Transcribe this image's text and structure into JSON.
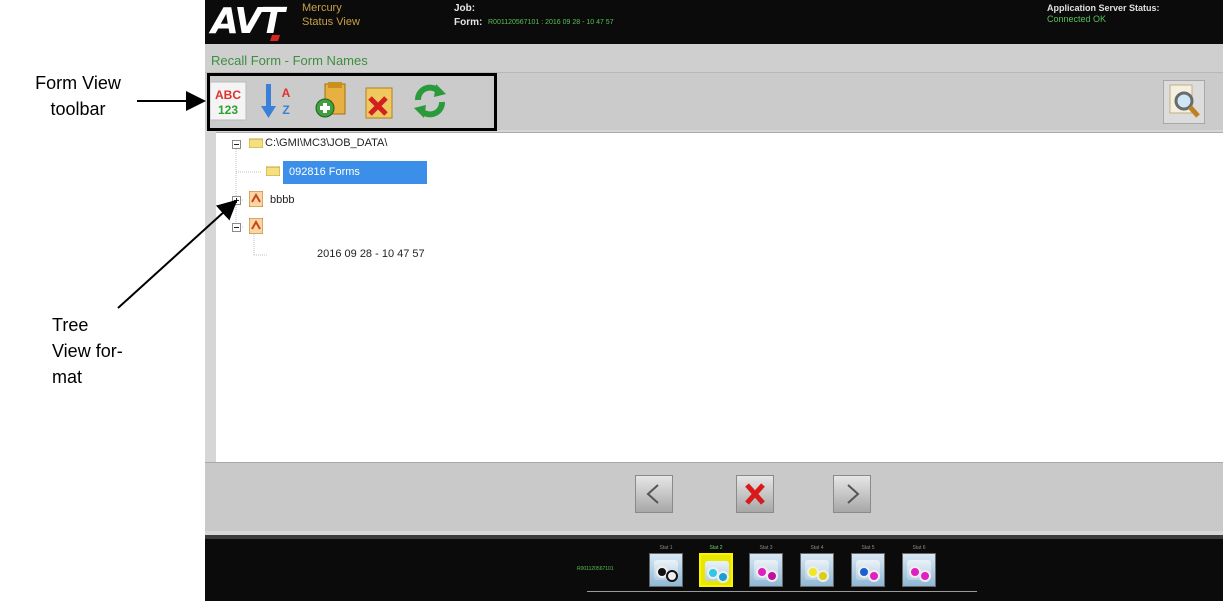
{
  "annotations": {
    "toolbar_label_line1": "Form View",
    "toolbar_label_line2": "toolbar",
    "tree_label_line1": "Tree",
    "tree_label_line2": "View for-",
    "tree_label_line3": "mat"
  },
  "header": {
    "logo": "AVT",
    "app_name": "Mercury",
    "app_sub": "Status View",
    "job_label": "Job:",
    "form_label": "Form:",
    "form_value": "R001120567101 : 2016 09 28 - 10 47 57",
    "server_label": "Application Server Status:",
    "server_value": "Connected OK"
  },
  "subtitle": "Recall Form - Form Names",
  "toolbar": {
    "buttons": [
      {
        "icon": "abc-123-icon"
      },
      {
        "icon": "sort-az-icon"
      },
      {
        "icon": "add-form-icon"
      },
      {
        "icon": "delete-icon"
      },
      {
        "icon": "refresh-icon"
      }
    ],
    "search_icon": "magnifier-icon"
  },
  "tree": {
    "root": "C:\\GMI\\MC3\\JOB_DATA\\",
    "selected": "092816 Forms",
    "node2": "bbbb",
    "node3": "",
    "leaf": "2016 09 28 - 10 47 57"
  },
  "nav": {
    "back_icon": "chevron-left-icon",
    "cancel_icon": "x-icon",
    "forward_icon": "chevron-right-icon"
  },
  "footer": {
    "job_id": "R001120567101",
    "stations": [
      {
        "label": "Stat 1",
        "colors": [
          "#111111",
          "#ffffff"
        ]
      },
      {
        "label": "Stat 2",
        "colors": [
          "#2fc8e8",
          "#1a9fd0"
        ]
      },
      {
        "label": "Stat 3",
        "colors": [
          "#e020c0",
          "#c010a0"
        ]
      },
      {
        "label": "Stat 4",
        "colors": [
          "#f0e820",
          "#d8d010"
        ]
      },
      {
        "label": "Stat 5",
        "colors": [
          "#1a60d0",
          "#e020c0"
        ]
      },
      {
        "label": "Stat 6",
        "colors": [
          "#e020c0",
          "#e020c0"
        ]
      }
    ],
    "active_station": 1
  }
}
